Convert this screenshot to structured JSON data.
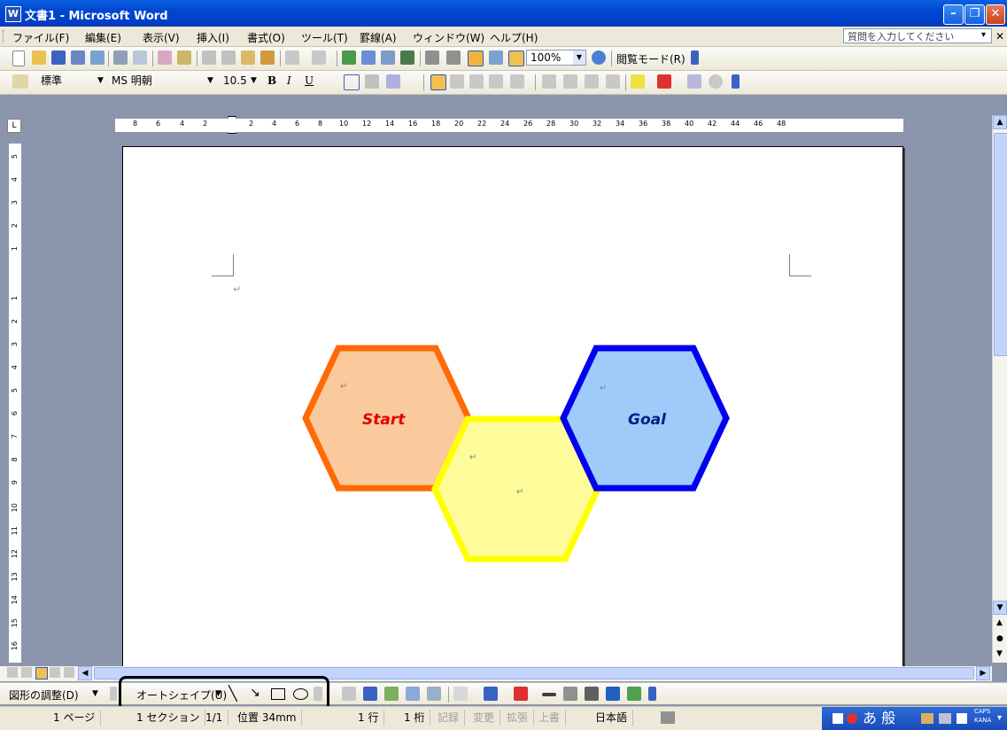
{
  "window": {
    "title": "文書1 - Microsoft Word",
    "app_icon": "word-icon"
  },
  "menubar": {
    "items": [
      "ファイル(F)",
      "編集(E)",
      "表示(V)",
      "挿入(I)",
      "書式(O)",
      "ツール(T)",
      "罫線(A)",
      "ウィンドウ(W)",
      "ヘルプ(H)"
    ],
    "help_placeholder": "質問を入力してください"
  },
  "standard_toolbar": {
    "zoom": "100%",
    "reading_mode": "閲覧モード(R)"
  },
  "format_toolbar": {
    "style": "標準",
    "font": "MS 明朝",
    "size": "10.5"
  },
  "ruler": {
    "h_ticks": [
      "8",
      "6",
      "4",
      "2",
      "2",
      "4",
      "6",
      "8",
      "10",
      "12",
      "14",
      "16",
      "18",
      "20",
      "22",
      "24",
      "26",
      "28",
      "30",
      "32",
      "34",
      "36",
      "38",
      "40",
      "42",
      "44",
      "46",
      "48"
    ],
    "v_ticks": [
      "5",
      "4",
      "3",
      "2",
      "1",
      "1",
      "2",
      "3",
      "4",
      "5",
      "6",
      "7",
      "8",
      "9",
      "10",
      "11",
      "12",
      "13",
      "14",
      "15",
      "16"
    ]
  },
  "document": {
    "hex_start": {
      "label": "Start",
      "fill": "#fac99c",
      "stroke": "#fe6a06"
    },
    "hex_middle": {
      "fill": "#fdfb9a",
      "stroke": "#ffff00"
    },
    "hex_goal": {
      "label": "Goal",
      "fill": "#9fcbfa",
      "stroke": "#0000ee"
    },
    "paragraph_mark": "↵"
  },
  "drawing_toolbar": {
    "adjust": "図形の調整(D)",
    "autoshape": "オートシェイプ(U)"
  },
  "statusbar": {
    "page": "1 ページ",
    "section": "1 セクション",
    "pages": "1/1",
    "position": "位置 34mm",
    "line": "1 行",
    "column": "1 桁",
    "rec": "記録",
    "trk": "変更",
    "ext": "拡張",
    "ovr": "上書",
    "lang": "日本語",
    "ime_mode": "あ 般",
    "caps": "CAPS",
    "kana": "KANA"
  },
  "colors": {
    "title_blue": "#0047d0",
    "chrome": "#ece9d8",
    "workspace": "#8b96ad"
  }
}
